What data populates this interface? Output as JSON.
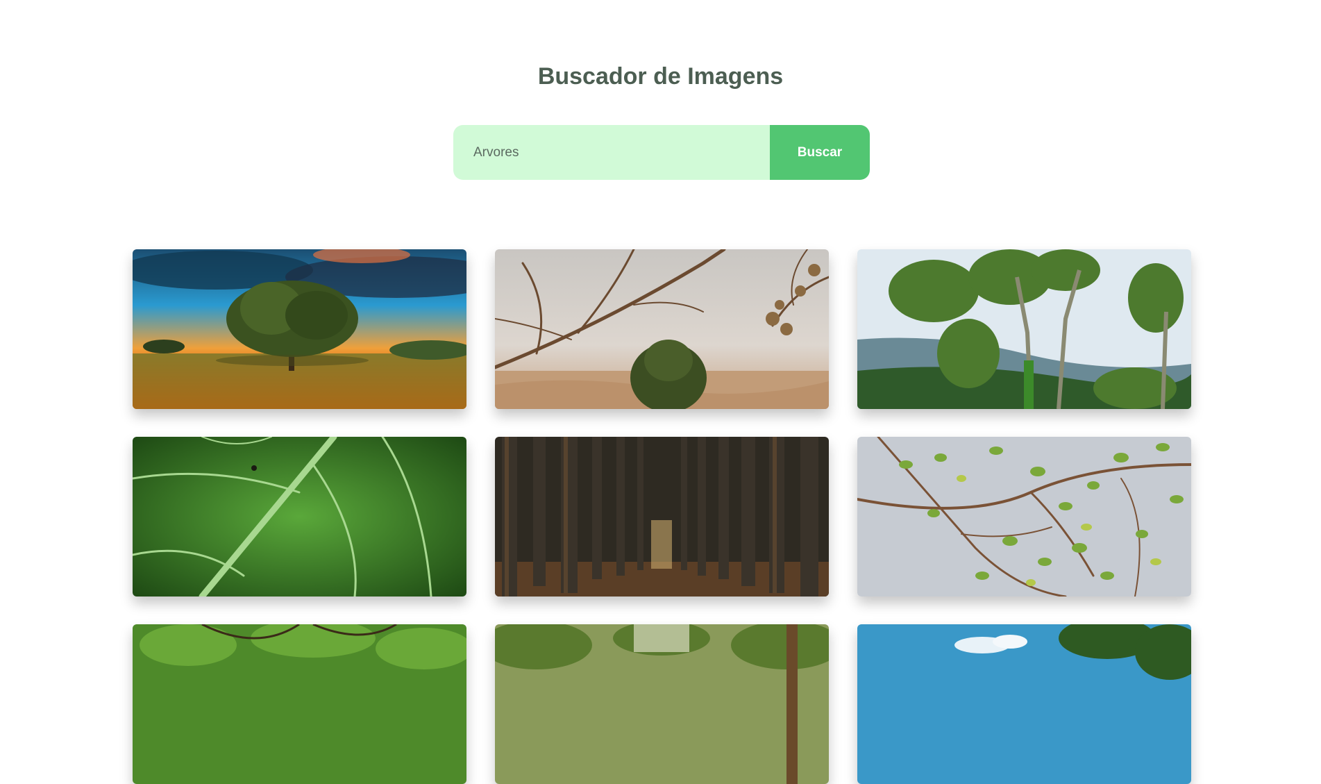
{
  "header": {
    "title": "Buscador de Imagens"
  },
  "search": {
    "value": "Arvores",
    "button_label": "Buscar"
  },
  "gallery": {
    "images": [
      {
        "name": "lone-tree-field-image"
      },
      {
        "name": "dry-branches-desert-image"
      },
      {
        "name": "tall-trees-hills-image"
      },
      {
        "name": "green-leaf-closeup-image"
      },
      {
        "name": "pine-forest-trunks-image"
      },
      {
        "name": "branches-leaves-sky-image"
      },
      {
        "name": "tree-canopy-image"
      },
      {
        "name": "forest-path-image"
      },
      {
        "name": "tree-blue-sky-image"
      }
    ]
  },
  "colors": {
    "title": "#4c5e52",
    "input_background": "#d1fad7",
    "button_background": "#52c672",
    "button_text": "#ffffff"
  }
}
